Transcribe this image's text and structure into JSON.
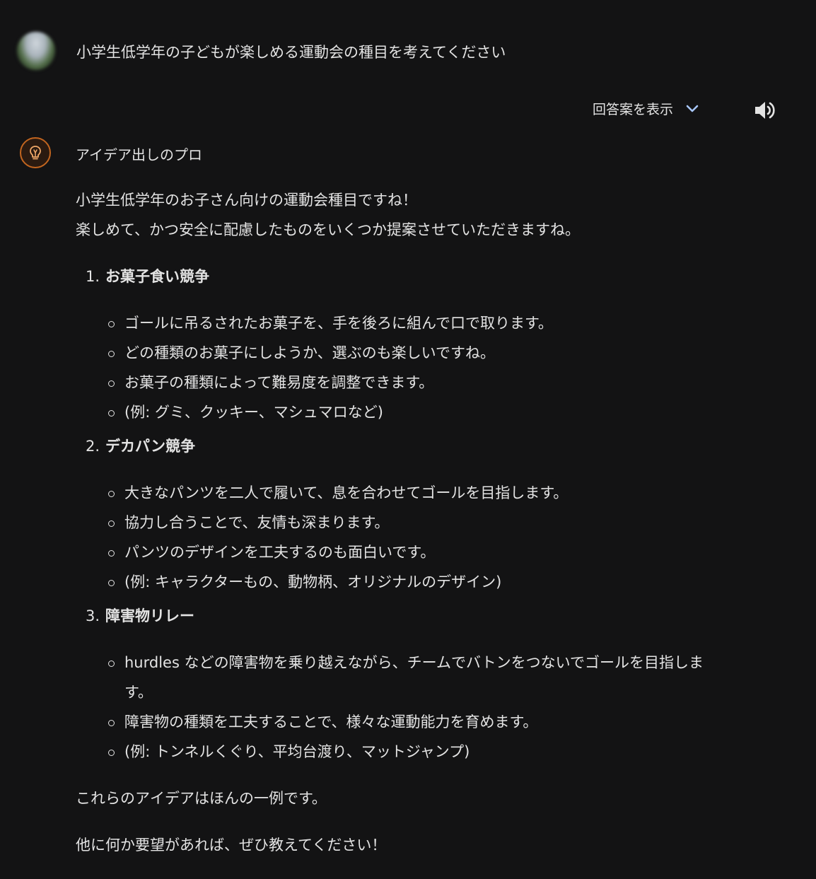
{
  "user": {
    "prompt": "小学生低学年の子どもが楽しめる運動会の種目を考えてください"
  },
  "toolbar": {
    "drafts_label": "回答案を表示",
    "drafts_icon": "chevron-down-icon",
    "speaker_icon": "speaker-icon",
    "chevron_color": "#a8c7fa"
  },
  "gem": {
    "name": "アイデア出しのプロ",
    "icon": "lightbulb-icon",
    "accent": "#c2651f"
  },
  "response": {
    "intro_line1": "小学生低学年のお子さん向けの運動会種目ですね！",
    "intro_line2": "楽しめて、かつ安全に配慮したものをいくつか提案させていただきますね。",
    "items": [
      {
        "number": "1.",
        "title": "お菓子食い競争",
        "points": [
          "ゴールに吊るされたお菓子を、手を後ろに組んで口で取ります。",
          "どの種類のお菓子にしようか、選ぶのも楽しいですね。",
          "お菓子の種類によって難易度を調整できます。",
          "(例: グミ、クッキー、マシュマロなど)"
        ]
      },
      {
        "number": "2.",
        "title": "デカパン競争",
        "points": [
          "大きなパンツを二人で履いて、息を合わせてゴールを目指します。",
          "協力し合うことで、友情も深まります。",
          "パンツのデザインを工夫するのも面白いです。",
          "(例: キャラクターもの、動物柄、オリジナルのデザイン)"
        ]
      },
      {
        "number": "3.",
        "title": "障害物リレー",
        "points": [
          "hurdles などの障害物を乗り越えながら、チームでバトンをつないでゴールを目指します。",
          "障害物の種類を工夫することで、様々な運動能力を育めます。",
          "(例: トンネルくぐり、平均台渡り、マットジャンプ)"
        ]
      }
    ],
    "outro": "これらのアイデアはほんの一例です。",
    "closing": "他に何か要望があれば、ぜひ教えてください！"
  }
}
